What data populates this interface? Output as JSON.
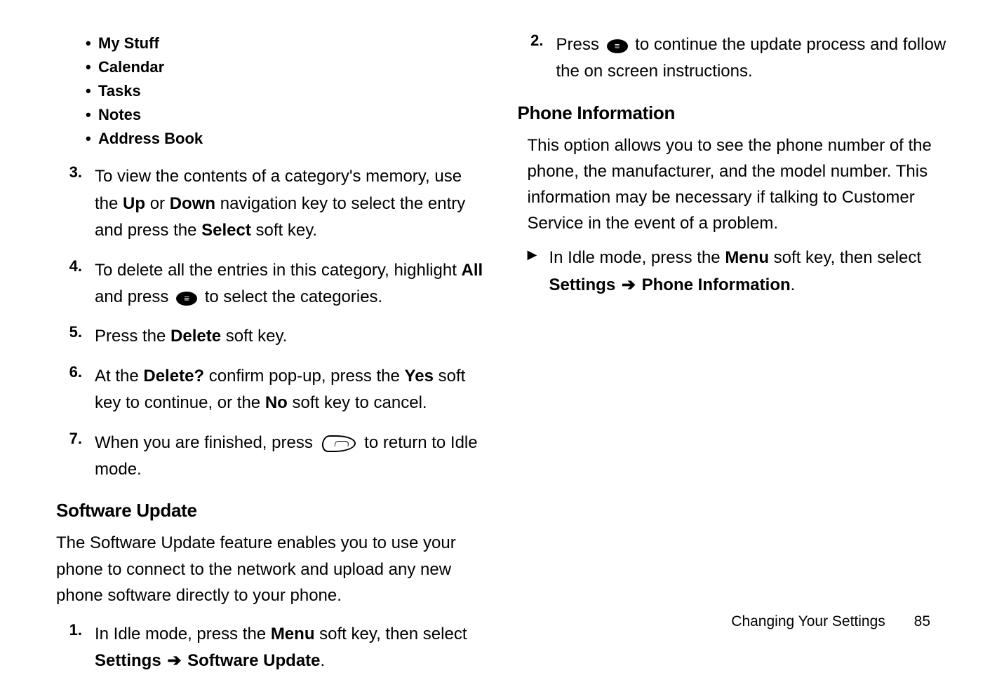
{
  "left": {
    "bullets": [
      "My Stuff",
      "Calendar",
      "Tasks",
      "Notes",
      "Address Book"
    ],
    "steps": {
      "s3": {
        "n": "3.",
        "pre": "To view the contents of a category's memory, use the ",
        "b1": "Up",
        "mid1": " or ",
        "b2": "Down",
        "mid2": " navigation key to select the entry and press the ",
        "b3": "Select",
        "post": " soft key."
      },
      "s4": {
        "n": "4.",
        "pre": "To delete all the entries in this category, highlight ",
        "b1": "All",
        "mid1": " and press ",
        "post": " to select the categories."
      },
      "s5": {
        "n": "5.",
        "pre": "Press the ",
        "b1": "Delete",
        "post": " soft key."
      },
      "s6": {
        "n": "6.",
        "pre": "At the ",
        "b1": "Delete?",
        "mid1": " confirm pop-up, press the ",
        "b2": "Yes",
        "mid2": " soft key to continue, or the ",
        "b3": "No",
        "post": " soft key to cancel."
      },
      "s7": {
        "n": "7.",
        "pre": "When you are finished, press ",
        "post": " to return to Idle mode."
      }
    },
    "subhead": "Software Update",
    "para": "The Software Update feature enables you to use your phone to connect to the network and upload any new phone software directly to your phone.",
    "s1": {
      "n": "1.",
      "pre": "In Idle mode, press the ",
      "b1": "Menu",
      "mid1": " soft key, then select ",
      "b2": "Settings",
      "arrow": " ➔ ",
      "b3": "Software Update",
      "post": "."
    }
  },
  "right": {
    "s2": {
      "n": "2.",
      "pre": "Press ",
      "post": " to continue the update process and follow the on screen instructions."
    },
    "subhead": "Phone Information",
    "para": "This option allows you to see the phone number of the phone, the manufacturer, and the model number. This information may be necessary if talking to Customer Service in the event of a problem.",
    "tri": {
      "pre": "In Idle mode, press the ",
      "b1": "Menu",
      "mid1": " soft key, then select ",
      "b2": "Settings",
      "arrow": " ➔ ",
      "b3": "Phone Information",
      "post": "."
    }
  },
  "footer": {
    "section": "Changing Your Settings",
    "page": "85"
  }
}
